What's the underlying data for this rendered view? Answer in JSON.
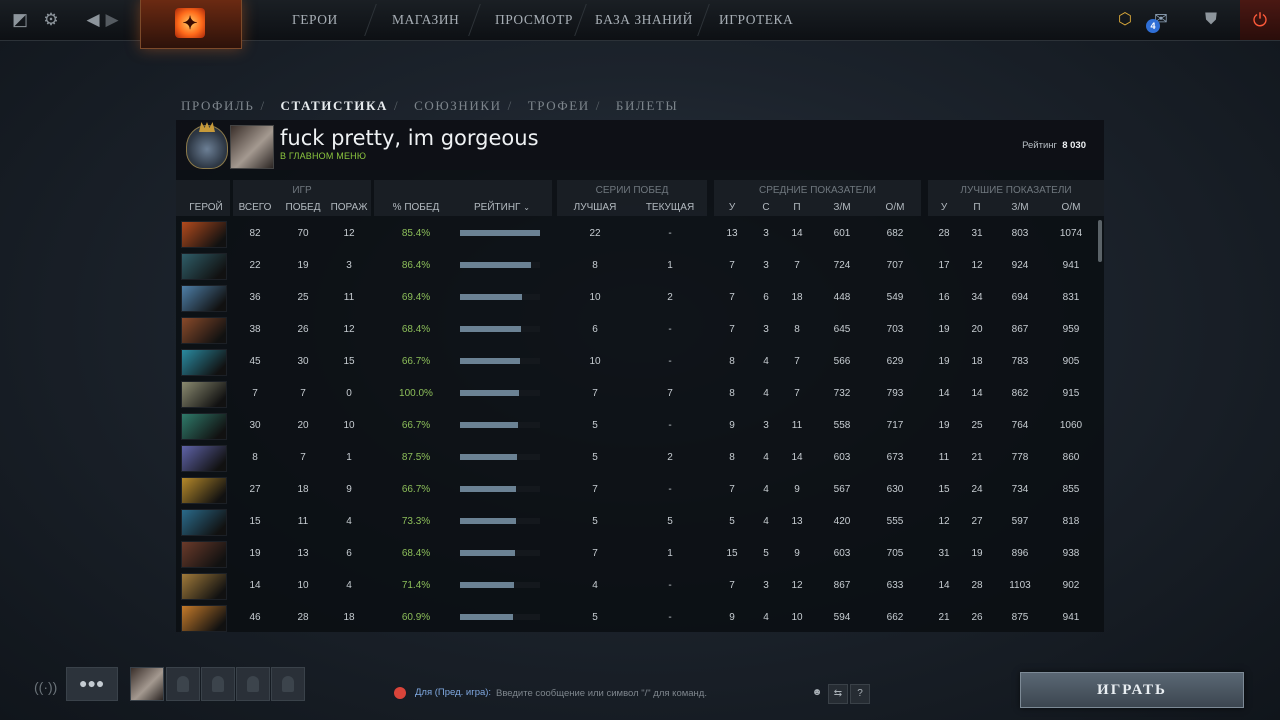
{
  "nav": {
    "items": [
      "ГЕРОИ",
      "МАГАЗИН",
      "ПРОСМОТР",
      "БАЗА ЗНАНИЙ",
      "ИГРОТЕКА"
    ],
    "notification_count": "4"
  },
  "subnav": {
    "tabs": [
      "ПРОФИЛЬ",
      "СТАТИСТИКА",
      "СОЮЗНИКИ",
      "ТРОФЕИ",
      "БИЛЕТЫ"
    ],
    "active_tab": "СТАТИСТИКА"
  },
  "profile": {
    "name": "fuck pretty, im gorgeous",
    "status": "В ГЛАВНОМ МЕНЮ",
    "rating_label": "Рейтинг",
    "rating_value": "8 030"
  },
  "table": {
    "groups": {
      "games": "ИГР",
      "streaks": "СЕРИИ ПОБЕД",
      "averages": "СРЕДНИЕ ПОКАЗАТЕЛИ",
      "bests": "ЛУЧШИЕ ПОКАЗАТЕЛИ"
    },
    "columns": {
      "hero": "ГЕРОЙ",
      "total": "ВСЕГО",
      "wins": "ПОБЕД",
      "losses": "ПОРАЖ",
      "winrate": "% ПОБЕД",
      "rating": "РЕЙТИНГ",
      "best_streak": "ЛУЧШАЯ",
      "current_streak": "ТЕКУЩАЯ",
      "avg_k": "У",
      "avg_d": "С",
      "avg_a": "П",
      "avg_gpm": "З/М",
      "avg_xpm": "О/М",
      "best_k": "У",
      "best_a": "П",
      "best_gpm": "З/М",
      "best_xpm": "О/М"
    },
    "rows": [
      {
        "total": "82",
        "wins": "70",
        "losses": "12",
        "winrate": "85.4%",
        "rating_bar": 1.0,
        "best_streak": "22",
        "current_streak": "-",
        "avg_k": "13",
        "avg_d": "3",
        "avg_a": "14",
        "avg_gpm": "601",
        "avg_xpm": "682",
        "best_k": "28",
        "best_a": "31",
        "best_gpm": "803",
        "best_xpm": "1074",
        "color": "#b24a1d"
      },
      {
        "total": "22",
        "wins": "19",
        "losses": "3",
        "winrate": "86.4%",
        "rating_bar": 0.89,
        "best_streak": "8",
        "current_streak": "1",
        "avg_k": "7",
        "avg_d": "3",
        "avg_a": "7",
        "avg_gpm": "724",
        "avg_xpm": "707",
        "best_k": "17",
        "best_a": "12",
        "best_gpm": "924",
        "best_xpm": "941",
        "color": "#2f5d68"
      },
      {
        "total": "36",
        "wins": "25",
        "losses": "11",
        "winrate": "69.4%",
        "rating_bar": 0.77,
        "best_streak": "10",
        "current_streak": "2",
        "avg_k": "7",
        "avg_d": "6",
        "avg_a": "18",
        "avg_gpm": "448",
        "avg_xpm": "549",
        "best_k": "16",
        "best_a": "34",
        "best_gpm": "694",
        "best_xpm": "831",
        "color": "#4e7fa8"
      },
      {
        "total": "38",
        "wins": "26",
        "losses": "12",
        "winrate": "68.4%",
        "rating_bar": 0.76,
        "best_streak": "6",
        "current_streak": "-",
        "avg_k": "7",
        "avg_d": "3",
        "avg_a": "8",
        "avg_gpm": "645",
        "avg_xpm": "703",
        "best_k": "19",
        "best_a": "20",
        "best_gpm": "867",
        "best_xpm": "959",
        "color": "#8a4a2a"
      },
      {
        "total": "45",
        "wins": "30",
        "losses": "15",
        "winrate": "66.7%",
        "rating_bar": 0.75,
        "best_streak": "10",
        "current_streak": "-",
        "avg_k": "8",
        "avg_d": "4",
        "avg_a": "7",
        "avg_gpm": "566",
        "avg_xpm": "629",
        "best_k": "19",
        "best_a": "18",
        "best_gpm": "783",
        "best_xpm": "905",
        "color": "#2a8aa0"
      },
      {
        "total": "7",
        "wins": "7",
        "losses": "0",
        "winrate": "100.0%",
        "rating_bar": 0.74,
        "best_streak": "7",
        "current_streak": "7",
        "avg_k": "8",
        "avg_d": "4",
        "avg_a": "7",
        "avg_gpm": "732",
        "avg_xpm": "793",
        "best_k": "14",
        "best_a": "14",
        "best_gpm": "862",
        "best_xpm": "915",
        "color": "#8a8a70"
      },
      {
        "total": "30",
        "wins": "20",
        "losses": "10",
        "winrate": "66.7%",
        "rating_bar": 0.72,
        "best_streak": "5",
        "current_streak": "-",
        "avg_k": "9",
        "avg_d": "3",
        "avg_a": "11",
        "avg_gpm": "558",
        "avg_xpm": "717",
        "best_k": "19",
        "best_a": "25",
        "best_gpm": "764",
        "best_xpm": "1060",
        "color": "#2f7a6a"
      },
      {
        "total": "8",
        "wins": "7",
        "losses": "1",
        "winrate": "87.5%",
        "rating_bar": 0.71,
        "best_streak": "5",
        "current_streak": "2",
        "avg_k": "8",
        "avg_d": "4",
        "avg_a": "14",
        "avg_gpm": "603",
        "avg_xpm": "673",
        "best_k": "11",
        "best_a": "21",
        "best_gpm": "778",
        "best_xpm": "860",
        "color": "#5f63a8"
      },
      {
        "total": "27",
        "wins": "18",
        "losses": "9",
        "winrate": "66.7%",
        "rating_bar": 0.7,
        "best_streak": "7",
        "current_streak": "-",
        "avg_k": "7",
        "avg_d": "4",
        "avg_a": "9",
        "avg_gpm": "567",
        "avg_xpm": "630",
        "best_k": "15",
        "best_a": "24",
        "best_gpm": "734",
        "best_xpm": "855",
        "color": "#b5892a"
      },
      {
        "total": "15",
        "wins": "11",
        "losses": "4",
        "winrate": "73.3%",
        "rating_bar": 0.7,
        "best_streak": "5",
        "current_streak": "5",
        "avg_k": "5",
        "avg_d": "4",
        "avg_a": "13",
        "avg_gpm": "420",
        "avg_xpm": "555",
        "best_k": "12",
        "best_a": "27",
        "best_gpm": "597",
        "best_xpm": "818",
        "color": "#2a6a8a"
      },
      {
        "total": "19",
        "wins": "13",
        "losses": "6",
        "winrate": "68.4%",
        "rating_bar": 0.69,
        "best_streak": "7",
        "current_streak": "1",
        "avg_k": "15",
        "avg_d": "5",
        "avg_a": "9",
        "avg_gpm": "603",
        "avg_xpm": "705",
        "best_k": "31",
        "best_a": "19",
        "best_gpm": "896",
        "best_xpm": "938",
        "color": "#6a3a2a"
      },
      {
        "total": "14",
        "wins": "10",
        "losses": "4",
        "winrate": "71.4%",
        "rating_bar": 0.67,
        "best_streak": "4",
        "current_streak": "-",
        "avg_k": "7",
        "avg_d": "3",
        "avg_a": "12",
        "avg_gpm": "867",
        "avg_xpm": "633",
        "best_k": "14",
        "best_a": "28",
        "best_gpm": "1103",
        "best_xpm": "902",
        "color": "#a07a3a"
      },
      {
        "total": "46",
        "wins": "28",
        "losses": "18",
        "winrate": "60.9%",
        "rating_bar": 0.66,
        "best_streak": "5",
        "current_streak": "-",
        "avg_k": "9",
        "avg_d": "4",
        "avg_a": "10",
        "avg_gpm": "594",
        "avg_xpm": "662",
        "best_k": "21",
        "best_a": "26",
        "best_gpm": "875",
        "best_xpm": "941",
        "color": "#c47a2a"
      }
    ]
  },
  "chat": {
    "channel": "Для (Пред. игра):",
    "placeholder": "Введите сообщение или символ \"/\" для команд.",
    "help": "?"
  },
  "play_button": "ИГРАТЬ"
}
